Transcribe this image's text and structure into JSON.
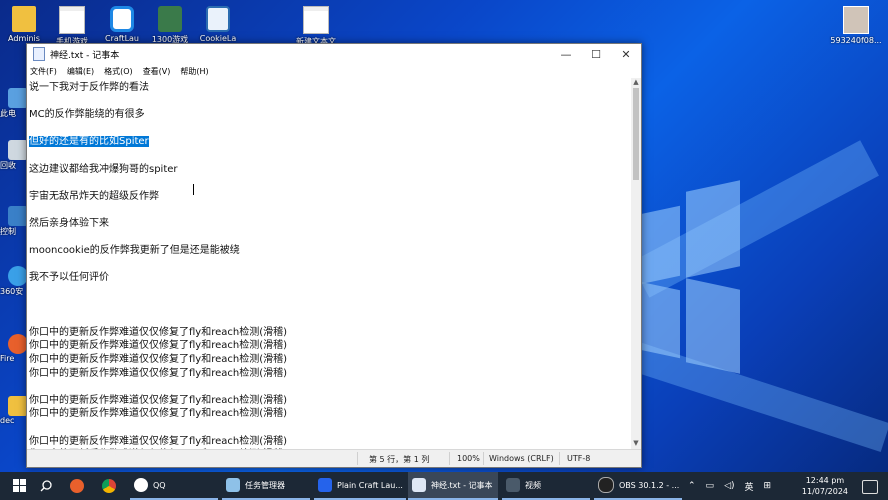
{
  "desktop": {
    "icons": [
      {
        "label": "Adminis"
      },
      {
        "label": "手机游戏"
      },
      {
        "label": "CraftLau"
      },
      {
        "label": "1300游戏"
      },
      {
        "label": "CookieLa"
      },
      {
        "label": "新建文本文"
      },
      {
        "label": "593240f08..."
      }
    ],
    "side_icons": [
      {
        "label": "此电"
      },
      {
        "label": "回收"
      },
      {
        "label": "控制"
      },
      {
        "label": "360安"
      },
      {
        "label": "Fire"
      },
      {
        "label": "dec"
      }
    ]
  },
  "notepad": {
    "title": "神经.txt - 记事本",
    "window_controls": {
      "minimize": "—",
      "maximize": "☐",
      "close": "✕"
    },
    "menu": [
      "文件(F)",
      "编辑(E)",
      "格式(O)",
      "查看(V)",
      "帮助(H)"
    ],
    "lines": [
      "说一下我对于反作弊的看法",
      "",
      "MC的反作弊能绕的有很多",
      "",
      "但好的还是有的比如Spiter",
      "",
      "这边建议都给我冲爆狗哥的spiter",
      "",
      "宇宙无敌吊炸天的超级反作弊",
      "",
      "然后亲身体验下来",
      "",
      "mooncookie的反作弊我更新了但是还是能被绕",
      "",
      "我不予以任何评价",
      "",
      "",
      "",
      "你口中的更新反作弊难道仅仅修复了fly和reach检测(滑稽)",
      "你口中的更新反作弊难道仅仅修复了fly和reach检测(滑稽)",
      "你口中的更新反作弊难道仅仅修复了fly和reach检测(滑稽)",
      "你口中的更新反作弊难道仅仅修复了fly和reach检测(滑稽)",
      "",
      "你口中的更新反作弊难道仅仅修复了fly和reach检测(滑稽)",
      "你口中的更新反作弊难道仅仅修复了fly和reach检测(滑稽)",
      "",
      "你口中的更新反作弊难道仅仅修复了fly和reach检测(滑稽)",
      "你口中的更新反作弊难道仅仅修复了fly和reach检测(滑稽)"
    ],
    "selected_line_index": 4,
    "status": {
      "position": "第 5 行，第 1 列",
      "zoom": "100%",
      "eol": "Windows (CRLF)",
      "encoding": "UTF-8"
    }
  },
  "taskbar": {
    "apps": [
      {
        "label": "QQ"
      },
      {
        "label": "任务管理器"
      },
      {
        "label": "Plain Craft Lau..."
      },
      {
        "label": "神经.txt - 记事本"
      },
      {
        "label": "视频"
      },
      {
        "label": "OBS 30.1.2 - ..."
      }
    ],
    "ime": "英",
    "time": "12:44 pm",
    "date": "11/07/2024"
  },
  "colors": {
    "selection": "#0078d7",
    "taskbar": "#1c2836",
    "desktop": "#0b62e6"
  }
}
